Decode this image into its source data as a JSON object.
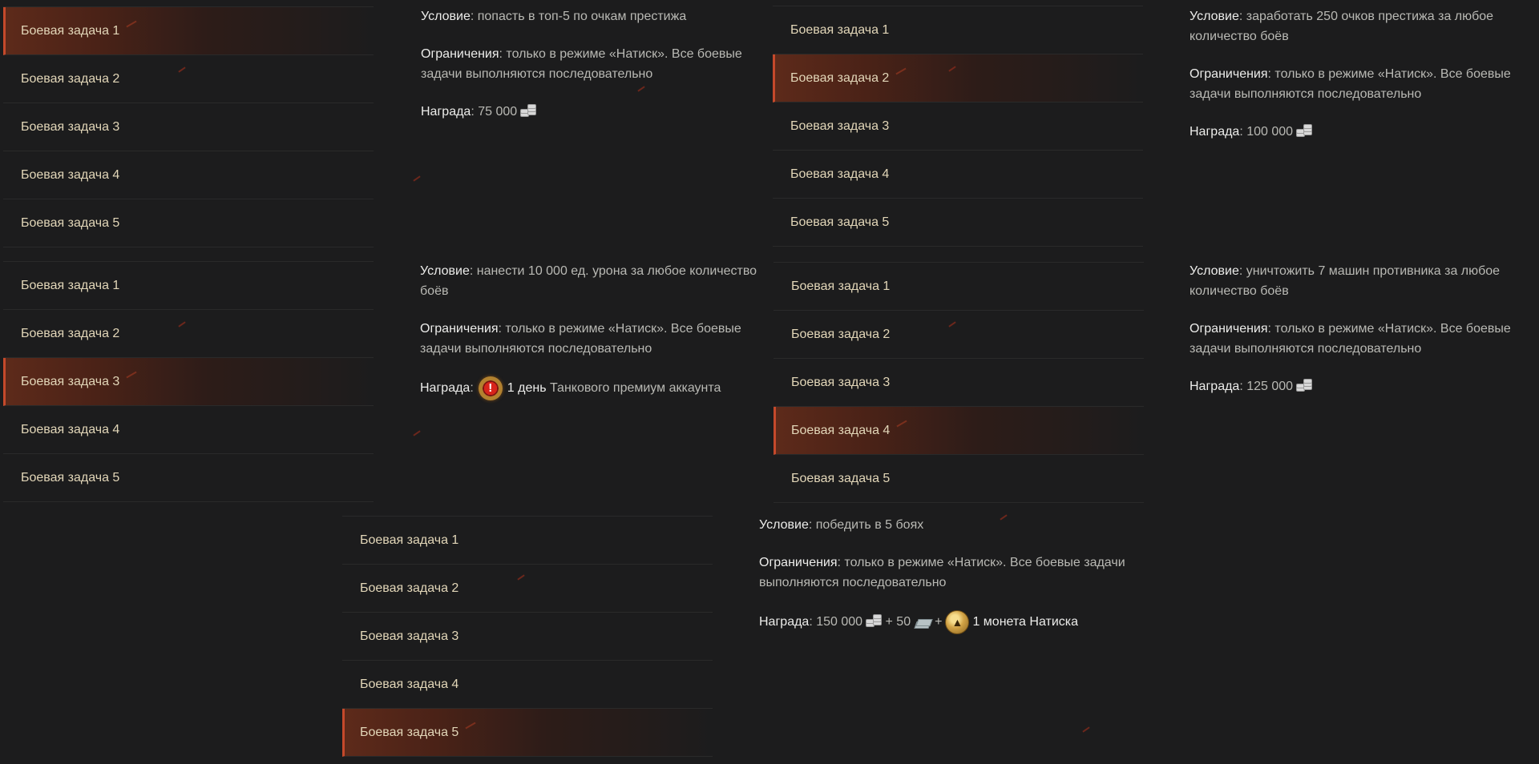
{
  "menu_items": [
    "Боевая задача 1",
    "Боевая задача 2",
    "Боевая задача 3",
    "Боевая задача 4",
    "Боевая задача 5"
  ],
  "labels": {
    "condition": "Условие",
    "restriction": "Ограничения",
    "reward": "Награда"
  },
  "colors": {
    "background": "#1c1c1d",
    "active_gradient": "#5d2a1a",
    "active_border": "#c5492b",
    "menu_text": "#e2d6b8"
  },
  "panels": [
    {
      "active_index": 0,
      "condition": ": попасть в топ-5 по очкам престижа",
      "restriction": ": только в режиме «Натиск». Все боевые задачи выполняются последовательно",
      "reward": ": 75 000",
      "reward_icons": [
        "credits-icon"
      ]
    },
    {
      "active_index": 1,
      "condition": ": заработать 250 очков престижа за любое количество боёв",
      "restriction": ": только в режиме «Натиск». Все боевые задачи выполняются последовательно",
      "reward": ": 100 000",
      "reward_icons": [
        "credits-icon"
      ]
    },
    {
      "active_index": 2,
      "condition": ": нанести 10 000 ед. урона за любое количество боёв",
      "restriction": ": только в режиме «Натиск». Все боевые задачи выполняются последовательно",
      "reward_prefix": ":",
      "reward_days": "1 день",
      "reward_rest": "Танкового премиум аккаунта",
      "reward_icons": [
        "premium-account-icon"
      ]
    },
    {
      "active_index": 3,
      "condition": ": уничтожить 7 машин противника за любое количество боёв",
      "restriction": ": только в режиме «Натиск». Все боевые задачи выполняются последовательно",
      "reward": ": 125 000",
      "reward_icons": [
        "credits-icon"
      ]
    },
    {
      "active_index": 4,
      "condition": ": победить в 5 боях",
      "restriction": ": только в режиме «Натиск». Все боевые задачи выполняются последовательно",
      "reward_part1": ": 150 000",
      "reward_part2": "+ 50",
      "reward_part3": "+",
      "reward_part4": "1 монета Натиска",
      "reward_icons": [
        "credits-icon",
        "bonds-icon",
        "onslaught-coin-icon"
      ]
    }
  ]
}
